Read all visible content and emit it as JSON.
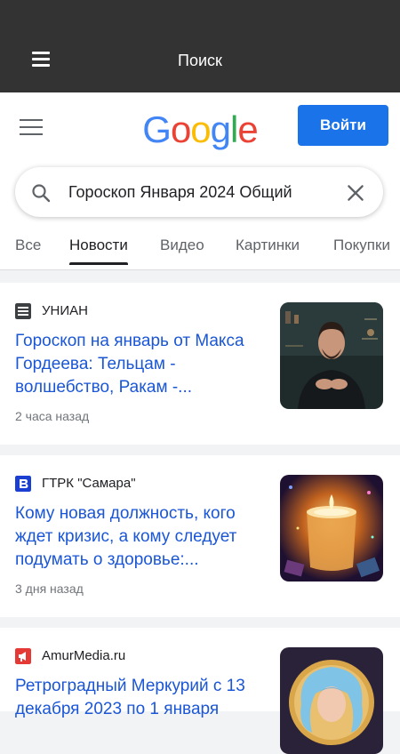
{
  "appbar": {
    "title": "Поиск",
    "menu_icon": "menu-icon"
  },
  "google": {
    "logo": [
      "G",
      "o",
      "o",
      "g",
      "l",
      "e"
    ],
    "logo_colors": [
      "#4285F4",
      "#EA4335",
      "#FBBC05",
      "#4285F4",
      "#34A853",
      "#EA4335"
    ],
    "signin_label": "Войти",
    "accent": "#1a73e8"
  },
  "search": {
    "query": "Гороскоп Января 2024 Общий",
    "search_icon": "search-icon",
    "clear_icon": "close-icon"
  },
  "tabs": [
    {
      "label": "Все"
    },
    {
      "label": "Новости",
      "active": true
    },
    {
      "label": "Видео"
    },
    {
      "label": "Картинки"
    },
    {
      "label": "Покупки"
    }
  ],
  "articles": [
    {
      "source": "УНИАН",
      "source_icon": "unian-icon",
      "headline": "Гороскоп на январь от Макса Гордеева: Тельцам - волшебство, Ракам -...",
      "time": "2 часа назад",
      "thumb_icon": "man-photo-thumbnail"
    },
    {
      "source": "ГТРК \"Самара\"",
      "source_icon": "gtrk-icon",
      "headline": "Кому новая должность, кого ждет кризис, а кому следует подумать о здоровье:...",
      "time": "3 дня назад",
      "thumb_icon": "candle-photo-thumbnail"
    },
    {
      "source": "AmurMedia.ru",
      "source_icon": "amurmedia-icon",
      "headline": "Ретроградный Меркурий с 13 декабря 2023 по 1 января",
      "time": "",
      "thumb_icon": "woman-illustration-thumbnail"
    }
  ]
}
